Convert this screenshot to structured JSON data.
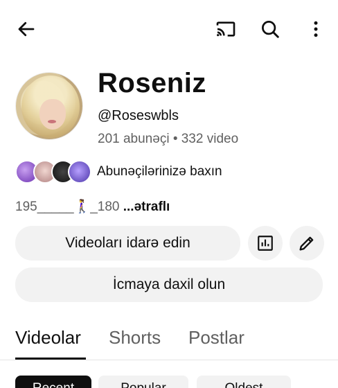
{
  "topbar": {
    "back_icon": "arrow-left-icon",
    "cast_icon": "cast-icon",
    "search_icon": "search-icon",
    "more_icon": "more-vert-icon"
  },
  "channel": {
    "name": "Roseniz",
    "handle": "@Roseswbls",
    "stats": "201 abunəçi • 332 video",
    "subscribers_link": "Abunəçilərinizə baxın",
    "description": "195_____🚶‍♀️_180 ",
    "more_label": "...ətraflı"
  },
  "actions": {
    "manage_label": "Videoları idarə edin",
    "analytics_icon": "analytics-icon",
    "edit_icon": "edit-pencil-icon",
    "icmaya_label": "İcmaya daxil olun"
  },
  "tabs": [
    {
      "label": "Videolar",
      "active": true
    },
    {
      "label": "Shorts",
      "active": false
    },
    {
      "label": "Postlar",
      "active": false
    }
  ],
  "chips": [
    {
      "label": "Recent",
      "selected": true
    },
    {
      "label": "Popular",
      "selected": false
    },
    {
      "label": "Oldest",
      "selected": false
    }
  ]
}
